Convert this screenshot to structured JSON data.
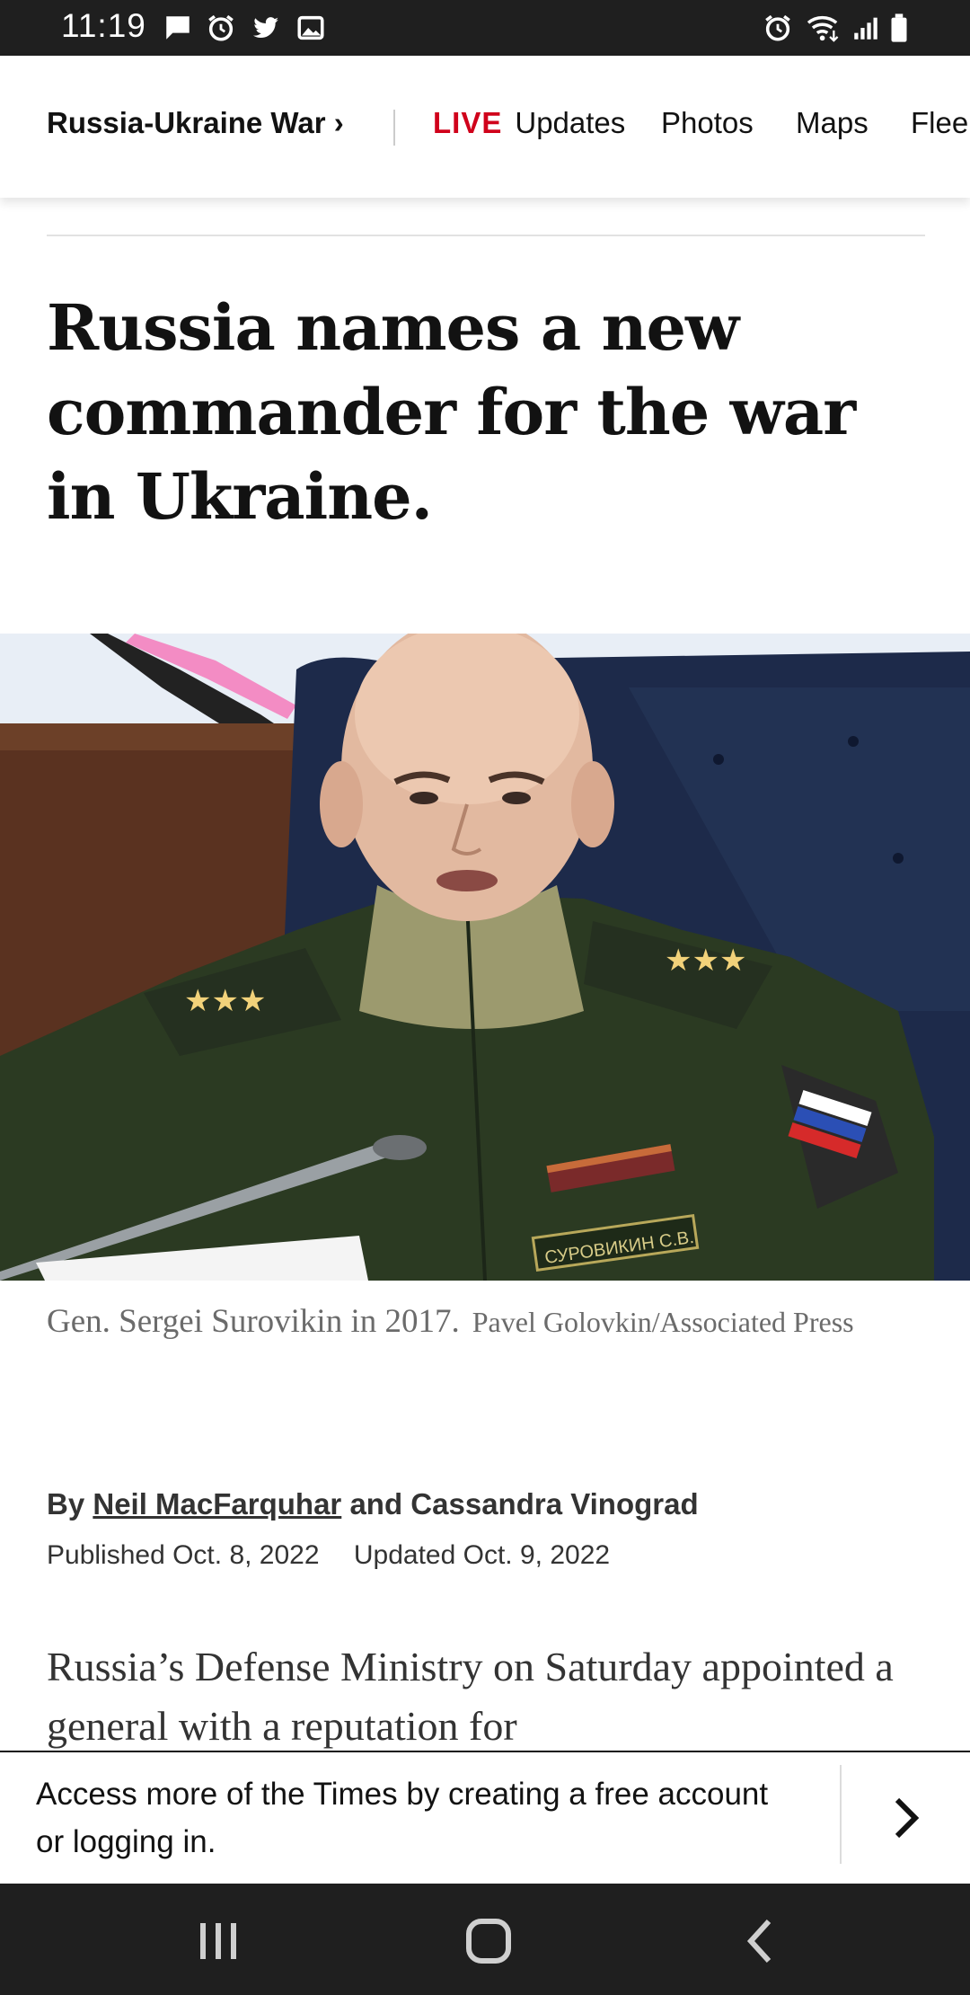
{
  "status_bar": {
    "time": "11:19"
  },
  "section_nav": {
    "section": "Russia-Ukraine War",
    "section_chevron": "›",
    "live": "LIVE",
    "updates": "Updates",
    "photos": "Photos",
    "maps": "Maps",
    "partial": "Flee"
  },
  "article": {
    "headline": "Russia names a new commander for the war in Ukraine.",
    "caption": "Gen. Sergei Surovikin in 2017.",
    "credit": "Pavel Golovkin/Associated Press",
    "byline_prefix": "By",
    "author1": "Neil MacFarquhar",
    "byline_and": "and",
    "author2": "Cassandra Vinograd",
    "published": "Published Oct. 8, 2022",
    "updated": "Updated Oct. 9, 2022",
    "body": "Russia’s Defense Ministry on Saturday appointed a general with a reputation for"
  },
  "banner": {
    "text": "Access more of the Times by creating a free account or logging in."
  },
  "photo_nametag": "СУРОВИКИН С.В.",
  "colors": {
    "live": "#d0021b",
    "status_bar": "#1f1f1f",
    "nav_bar": "#1f1f1f"
  }
}
